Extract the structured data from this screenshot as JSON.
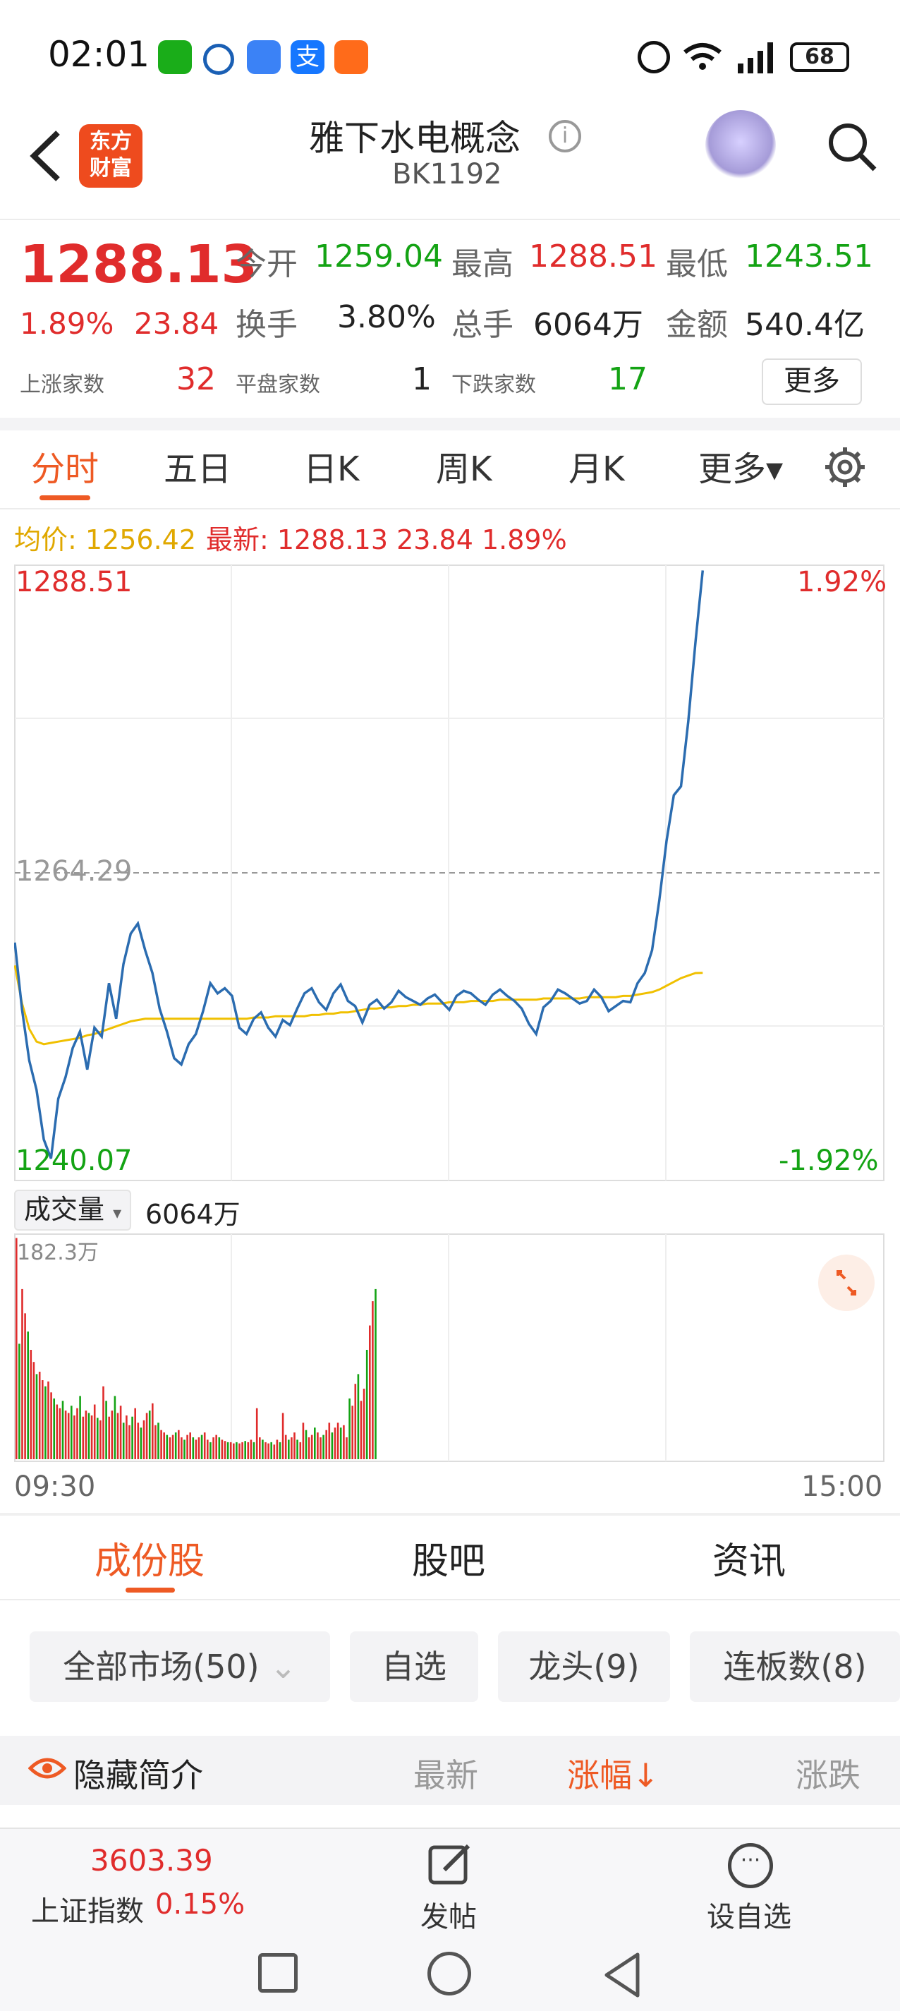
{
  "status_bar": {
    "time": "02:01",
    "battery": "68",
    "signal": "6"
  },
  "header": {
    "title": "雅下水电概念",
    "code": "BK1192",
    "logo_line1": "东方",
    "logo_line2": "财富"
  },
  "quote": {
    "price": "1288.13",
    "change_pct": "1.89%",
    "change": "23.84",
    "open_label": "今开",
    "open": "1259.04",
    "high_label": "最高",
    "high": "1288.51",
    "low_label": "最低",
    "low": "1243.51",
    "turnover_label": "换手",
    "turnover": "3.80%",
    "volume_label": "总手",
    "volume": "6064万",
    "amount_label": "金额",
    "amount": "540.4亿",
    "up_label": "上涨家数",
    "up": "32",
    "flat_label": "平盘家数",
    "flat": "1",
    "down_label": "下跌家数",
    "down": "17",
    "more": "更多"
  },
  "tabs": [
    "分时",
    "五日",
    "日K",
    "周K",
    "月K",
    "更多▾"
  ],
  "chart_info": {
    "avg_label": "均价: 1256.42",
    "latest_label": "最新: 1288.13 23.84 1.89%"
  },
  "price_axis": {
    "top": "1288.51",
    "mid": "1264.29",
    "bottom": "1240.07",
    "top_pct": "1.92%",
    "bottom_pct": "-1.92%"
  },
  "volume_axis": {
    "label": "成交量",
    "value": "6064万",
    "max": "182.3万"
  },
  "time_axis": {
    "start": "09:30",
    "end": "15:00"
  },
  "chart_data": {
    "type": "line",
    "title": "",
    "xlabel": "",
    "ylabel": "",
    "ylim": [
      1240.07,
      1288.51
    ],
    "x": [
      0,
      2,
      4,
      6,
      8,
      10,
      12,
      14,
      16,
      18,
      20,
      22,
      24,
      26,
      28,
      30,
      32,
      34,
      36,
      38,
      40,
      42,
      44,
      46,
      48,
      50,
      52,
      54,
      56,
      58,
      60,
      62,
      64,
      66,
      68,
      70,
      72,
      74,
      76,
      78,
      80,
      82,
      84,
      86,
      88,
      90,
      92,
      94,
      96,
      98,
      100,
      102,
      104,
      106,
      108,
      110,
      112,
      114,
      116,
      118,
      120,
      122,
      124,
      126,
      128,
      130,
      132,
      134,
      136,
      138,
      140,
      142,
      144,
      146,
      148,
      150,
      152,
      154,
      156,
      158,
      160,
      162,
      164,
      166,
      168,
      170,
      172,
      174,
      176,
      178,
      180,
      182,
      184,
      186,
      188,
      190,
      192,
      194,
      196,
      198,
      200,
      202,
      204,
      206,
      208,
      210,
      212,
      214,
      216,
      218,
      220,
      222,
      224,
      226,
      228,
      230,
      232,
      234,
      236,
      238,
      240
    ],
    "series": [
      {
        "values": [
          1258.8,
          1253.5,
          1249.5,
          1247.2,
          1243.3,
          1241.8,
          1246.5,
          1248.2,
          1250.5,
          1251.8,
          1248.8,
          1252.1,
          1251.4,
          1255.6,
          1252.8,
          1257.1,
          1259.5,
          1260.3,
          1258.2,
          1256.4,
          1253.6,
          1251.8,
          1249.7,
          1249.2,
          1250.8,
          1251.6,
          1253.4,
          1255.6,
          1254.8,
          1255.2,
          1254.6,
          1252.1,
          1251.6,
          1252.8,
          1253.3,
          1252.1,
          1251.4,
          1252.7,
          1252.3,
          1253.6,
          1254.8,
          1255.2,
          1254.1,
          1253.5,
          1254.8,
          1255.5,
          1254.2,
          1253.8,
          1252.5,
          1253.9,
          1254.3,
          1253.6,
          1254.1,
          1255.0,
          1254.5,
          1254.2,
          1253.9,
          1254.4,
          1254.7,
          1254.1,
          1253.5,
          1254.6,
          1255.0,
          1254.8,
          1254.3,
          1253.9,
          1254.7,
          1255.1,
          1254.6,
          1254.2,
          1253.6,
          1252.4,
          1251.6,
          1253.7,
          1254.2,
          1255.1,
          1254.8,
          1254.4,
          1254.0,
          1254.2,
          1255.1,
          1254.5,
          1253.4,
          1253.8,
          1254.2,
          1254.1,
          1255.6,
          1256.4,
          1258.2,
          1262.1,
          1266.8,
          1270.4,
          1271.1,
          1276.2,
          1282.5,
          1288.1
        ]
      },
      {
        "values": [
          1257.0,
          1254.0,
          1252.0,
          1251.0,
          1250.8,
          1250.9,
          1251.0,
          1251.1,
          1251.2,
          1251.3,
          1251.5,
          1251.6,
          1251.8,
          1252.0,
          1252.2,
          1252.4,
          1252.6,
          1252.7,
          1252.8,
          1252.8,
          1252.8,
          1252.8,
          1252.8,
          1252.8,
          1252.8,
          1252.8,
          1252.8,
          1252.8,
          1252.8,
          1252.8,
          1252.8,
          1252.8,
          1252.8,
          1252.9,
          1252.9,
          1252.9,
          1253.0,
          1253.0,
          1253.0,
          1253.0,
          1253.0,
          1253.1,
          1253.1,
          1253.2,
          1253.2,
          1253.3,
          1253.3,
          1253.4,
          1253.5,
          1253.6,
          1253.6,
          1253.7,
          1253.7,
          1253.8,
          1253.8,
          1253.9,
          1253.9,
          1254.0,
          1254.0,
          1254.0,
          1254.1,
          1254.1,
          1254.1,
          1254.2,
          1254.2,
          1254.2,
          1254.2,
          1254.3,
          1254.3,
          1254.3,
          1254.3,
          1254.3,
          1254.3,
          1254.4,
          1254.4,
          1254.4,
          1254.4,
          1254.4,
          1254.4,
          1254.5,
          1254.5,
          1254.5,
          1254.5,
          1254.5,
          1254.6,
          1254.6,
          1254.7,
          1254.8,
          1254.9,
          1255.1,
          1255.4,
          1255.7,
          1256.0,
          1256.2,
          1256.4,
          1256.42
        ]
      }
    ]
  },
  "volume_data": {
    "ymax_wan": 182.3,
    "values": [
      182,
      95,
      140,
      120,
      105,
      90,
      80,
      70,
      72,
      65,
      60,
      64,
      55,
      50,
      45,
      42,
      48,
      40,
      38,
      44,
      36,
      42,
      52,
      35,
      40,
      38,
      36,
      45,
      34,
      32,
      60,
      48,
      35,
      40,
      52,
      38,
      44,
      30,
      36,
      28,
      35,
      42,
      30,
      26,
      32,
      38,
      40,
      46,
      28,
      30,
      24,
      22,
      20,
      18,
      20,
      22,
      24,
      18,
      16,
      20,
      22,
      18,
      16,
      18,
      20,
      22,
      16,
      14,
      18,
      20,
      18,
      16,
      15,
      14,
      14,
      13,
      14,
      13,
      14,
      15,
      14,
      16,
      14,
      42,
      18,
      16,
      14,
      13,
      14,
      12,
      16,
      14,
      38,
      20,
      16,
      18,
      22,
      16,
      14,
      30,
      24,
      18,
      20,
      26,
      22,
      18,
      20,
      24,
      30,
      22,
      26,
      30,
      26,
      28,
      18,
      50,
      44,
      62,
      70,
      48,
      58,
      90,
      110,
      130,
      140
    ],
    "colors": "alternating red/green"
  },
  "bottom_tabs": [
    "成份股",
    "股吧",
    "资讯"
  ],
  "filters": [
    "全部市场(50)",
    "自选",
    "龙头(9)",
    "连板数(8)"
  ],
  "list_header": {
    "hide": "隐藏简介",
    "col1": "最新",
    "col2": "涨幅↓",
    "col3": "涨跌"
  },
  "footer": {
    "index_value": "3603.39",
    "index_name": "上证指数",
    "index_pct": "0.15%",
    "post": "发帖",
    "add_watch": "设自选"
  },
  "colors": {
    "accent": "#ee5a24",
    "up": "#e02c2c",
    "down": "#14a314",
    "avg_line": "#f0c000",
    "price_line": "#2b6cb0"
  }
}
